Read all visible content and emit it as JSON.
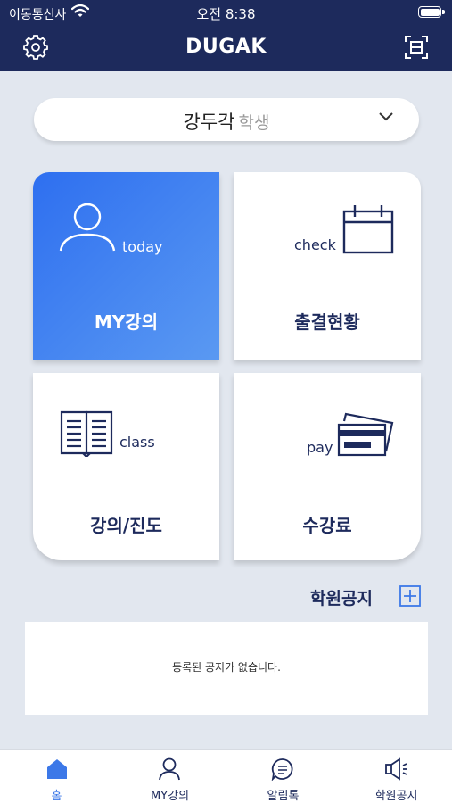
{
  "status_bar": {
    "carrier": "이동통신사",
    "time": "오전 8:38"
  },
  "header": {
    "title": "DUGAK"
  },
  "selector": {
    "name": "강두각",
    "role": "학생"
  },
  "tiles": [
    {
      "label": "MY강의",
      "sub": "today",
      "icon": "person-icon"
    },
    {
      "label": "출결현황",
      "sub": "check",
      "icon": "calendar-icon"
    },
    {
      "label": "강의/진도",
      "sub": "class",
      "icon": "book-icon"
    },
    {
      "label": "수강료",
      "sub": "pay",
      "icon": "credit-card-icon"
    }
  ],
  "notice": {
    "title": "학원공지",
    "empty_text": "등록된 공지가 없습니다."
  },
  "tabbar": [
    {
      "label": "홈",
      "icon": "home-icon",
      "active": true
    },
    {
      "label": "MY강의",
      "icon": "person-icon"
    },
    {
      "label": "알림톡",
      "icon": "chat-icon"
    },
    {
      "label": "학원공지",
      "icon": "megaphone-icon"
    }
  ],
  "colors": {
    "navy": "#1d2a5c",
    "accent": "#3c78e8",
    "background": "#e2e7ef"
  }
}
